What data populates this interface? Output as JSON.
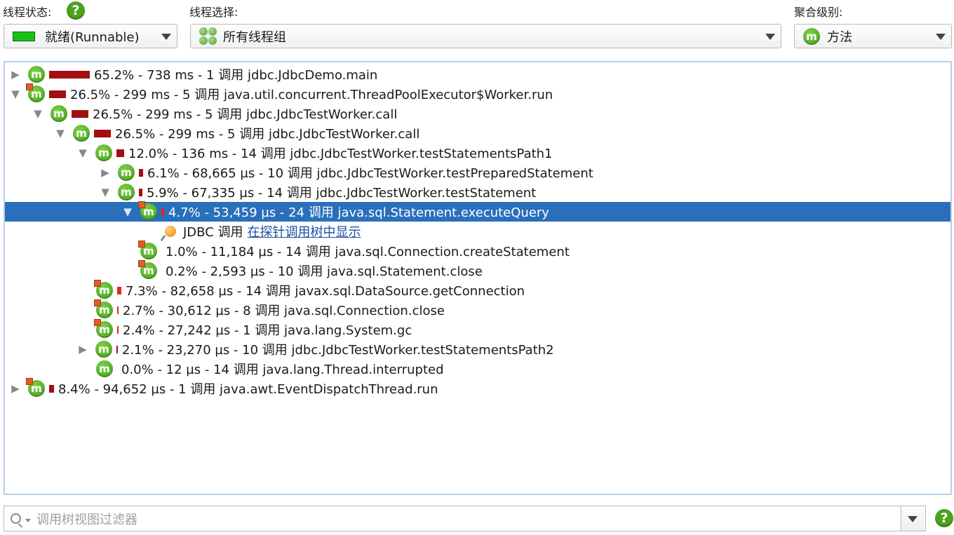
{
  "header": {
    "thread_state_label": "线程状态:",
    "thread_select_label": "线程选择:",
    "aggregation_label": "聚合级别:",
    "help_glyph": "?"
  },
  "dropdowns": {
    "thread_state": "就绪(Runnable)",
    "thread_group": "所有线程组",
    "aggregation": "方法"
  },
  "icons": {
    "method_glyph": "m",
    "expanded": "▼",
    "collapsed": "▶"
  },
  "tree": [
    {
      "text": "65.2% - 738 ms - 1 调用 jdbc.JdbcDemo.main",
      "toggle": "collapsed",
      "bar": 58
    },
    {
      "text": "26.5% - 299 ms - 5 调用 java.util.concurrent.ThreadPoolExecutor$Worker.run",
      "toggle": "expanded",
      "bar": 24
    },
    {
      "text": "26.5% - 299 ms - 5 调用 jdbc.JdbcTestWorker.call",
      "toggle": "expanded",
      "bar": 24
    },
    {
      "text": "26.5% - 299 ms - 5 调用 jdbc.JdbcTestWorker.call",
      "toggle": "expanded",
      "bar": 24
    },
    {
      "text": "12.0% - 136 ms - 14 调用 jdbc.JdbcTestWorker.testStatementsPath1",
      "toggle": "expanded",
      "bar": 11
    },
    {
      "text": "6.1% - 68,665 µs - 10 调用 jdbc.JdbcTestWorker.testPreparedStatement",
      "toggle": "collapsed",
      "bar": 6
    },
    {
      "text": "5.9% - 67,335 µs - 14 调用 jdbc.JdbcTestWorker.testStatement",
      "toggle": "expanded",
      "bar": 5
    },
    {
      "text": "4.7% - 53,459 µs - 24 调用 java.sql.Statement.executeQuery",
      "toggle": "expanded",
      "bar": 4,
      "selected": true
    },
    {
      "jdbc_prefix": "JDBC 调用",
      "jdbc_link": "在探针调用树中显示"
    },
    {
      "text": "1.0% - 11,184 µs - 14 调用 java.sql.Connection.createStatement",
      "toggle": "none",
      "bar": 0
    },
    {
      "text": "0.2% - 2,593 µs - 10 调用 java.sql.Statement.close",
      "toggle": "none",
      "bar": 0
    },
    {
      "text": "7.3% - 82,658 µs - 14 调用 javax.sql.DataSource.getConnection",
      "toggle": "none",
      "bar": 6
    },
    {
      "text": "2.7% - 30,612 µs - 8 调用 java.sql.Connection.close",
      "toggle": "none",
      "bar": 2
    },
    {
      "text": "2.4% - 27,242 µs - 1 调用 java.lang.System.gc",
      "toggle": "none",
      "bar": 2
    },
    {
      "text": "2.1% - 23,270 µs - 10 调用 jdbc.JdbcTestWorker.testStatementsPath2",
      "toggle": "collapsed",
      "bar": 2
    },
    {
      "text": "0.0% - 12 µs - 14 调用 java.lang.Thread.interrupted",
      "toggle": "none",
      "bar": 0
    },
    {
      "text": "8.4% - 94,652 µs - 1 调用 java.awt.EventDispatchThread.run",
      "toggle": "collapsed",
      "bar": 7
    }
  ],
  "filter": {
    "placeholder": "调用树视图过滤器"
  },
  "colors": {
    "selection": "#2a6fbb",
    "bar_dark": "#a30e10",
    "bar_light": "#e0291e",
    "method_icon": "#4ea21c"
  }
}
